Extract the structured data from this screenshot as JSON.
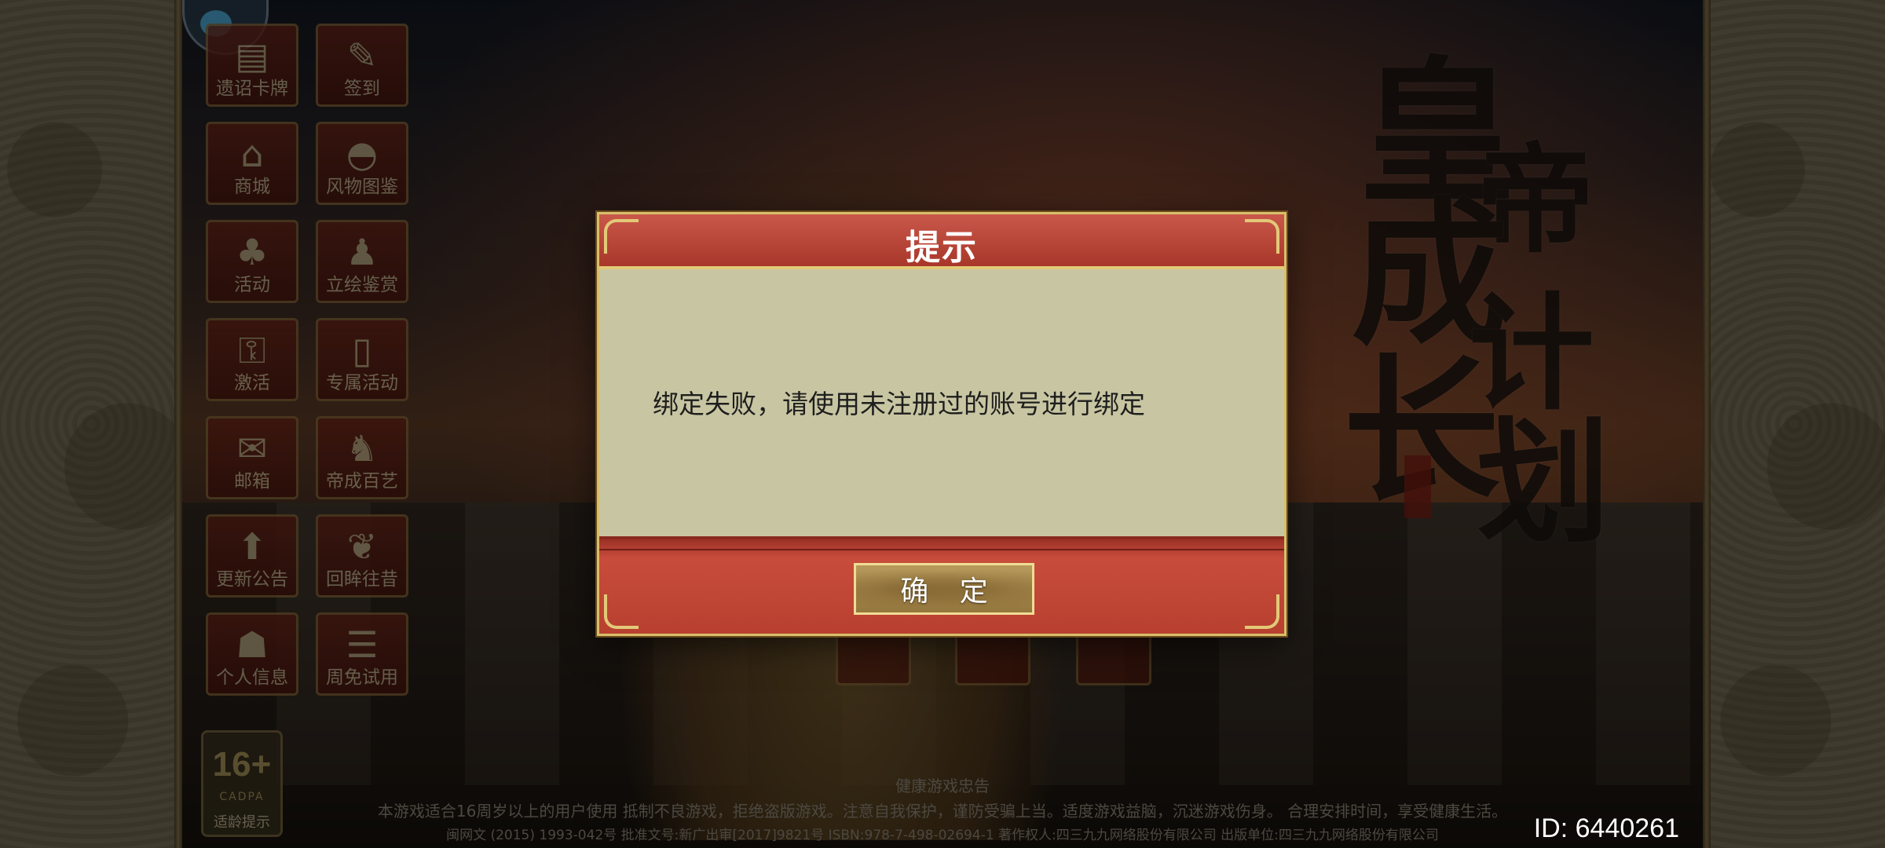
{
  "dialog": {
    "title": "提示",
    "message": "绑定失败，请使用未注册过的账号进行绑定",
    "confirm_label": "确 定"
  },
  "menu": {
    "items": [
      {
        "label": "遗诏卡牌",
        "icon": "scroll-icon"
      },
      {
        "label": "签到",
        "icon": "signin-icon"
      },
      {
        "label": "商城",
        "icon": "shop-icon"
      },
      {
        "label": "风物图鉴",
        "icon": "fan-icon"
      },
      {
        "label": "活动",
        "icon": "event-icon"
      },
      {
        "label": "立绘鉴赏",
        "icon": "portrait-icon"
      },
      {
        "label": "激活",
        "icon": "key-icon"
      },
      {
        "label": "专属活动",
        "icon": "exclusive-icon"
      },
      {
        "label": "邮箱",
        "icon": "mail-icon"
      },
      {
        "label": "帝成百艺",
        "icon": "chess-icon"
      },
      {
        "label": "更新公告",
        "icon": "upload-icon"
      },
      {
        "label": "回眸往昔",
        "icon": "leaf-icon"
      },
      {
        "label": "个人信息",
        "icon": "profile-icon"
      },
      {
        "label": "周免试用",
        "icon": "trial-icon"
      }
    ]
  },
  "logo": {
    "chars": [
      "皇",
      "帝",
      "成",
      "长",
      "计",
      "划"
    ]
  },
  "age_rating": {
    "age": "16+",
    "org": "CADPA",
    "tip": "适龄提示"
  },
  "footer": {
    "title": "健康游戏忠告",
    "line1": "本游戏适合16周岁以上的用户使用     抵制不良游戏，拒绝盗版游戏。注意自我保护，谨防受骗上当。适度游戏益脑，沉迷游戏伤身。 合理安排时间，享受健康生活。",
    "line2": "闽网文 (2015) 1993-042号  批准文号:新广出审[2017]9821号  ISBN:978-7-498-02694-1  著作权人:四三九九网络股份有限公司 出版单位:四三九九网络股份有限公司"
  },
  "id_label": "ID: 6440261",
  "colors": {
    "dialog_red": "#b8402f",
    "dialog_body": "#c8c6a2",
    "gold_border": "#e2c978",
    "button_gold": "#a88a4c"
  }
}
